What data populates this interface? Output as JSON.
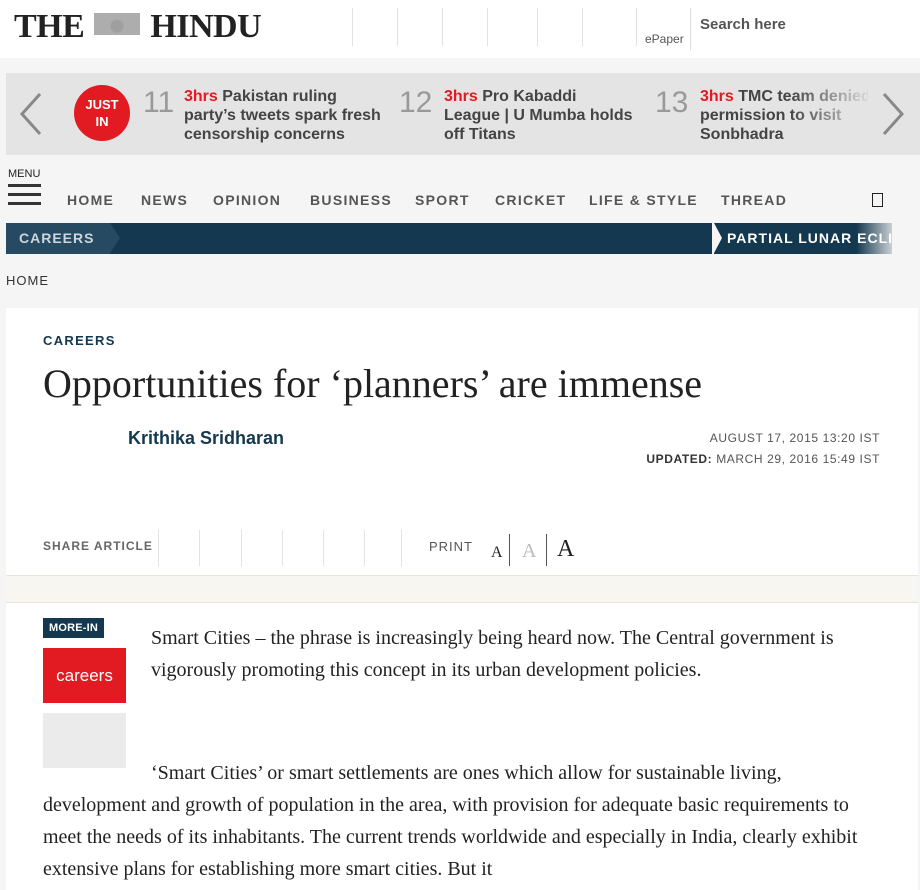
{
  "header": {
    "logo_left": "THE",
    "logo_right": "HINDU",
    "epaper": "ePaper",
    "search_placeholder": "Search here"
  },
  "ticker": {
    "badge": "JUST IN",
    "items": [
      {
        "num": "11",
        "time": "3hrs",
        "text": " Pakistan ruling party’s tweets spark fresh censorship concerns"
      },
      {
        "num": "12",
        "time": "3hrs",
        "text": " Pro Kabaddi League | U Mumba holds off Titans"
      },
      {
        "num": "13",
        "time": "3hrs",
        "text": " TMC team denied permission to visit Sonbhadra"
      }
    ]
  },
  "menu": {
    "label": "MENU",
    "items": [
      "HOME",
      "NEWS",
      "OPINION",
      "BUSINESS",
      "SPORT",
      "CRICKET",
      "LIFE & STYLE",
      "THREAD"
    ]
  },
  "section_bar": {
    "current": "CAREERS",
    "trending": "PARTIAL LUNAR ECLIPSE"
  },
  "breadcrumb": "HOME",
  "article": {
    "kicker": "CAREERS",
    "title": "Opportunities for ‘planners’ are immense",
    "author": "Krithika Sridharan",
    "published": "AUGUST 17, 2015 13:20 IST",
    "updated_label": "UPDATED:",
    "updated": "MARCH 29, 2016 15:49 IST",
    "share_label": "SHARE ARTICLE",
    "print_label": "PRINT",
    "font_sizes": [
      "A",
      "A",
      "A"
    ],
    "more_in": "MORE-IN",
    "tag": "careers",
    "paragraph1": "Smart Cities – the phrase is increasingly being heard now. The Central government is vigorously promoting this concept in its urban development policies.",
    "paragraph2": "‘Smart Cities’ or smart settlements are ones which allow for sustainable living, development and growth of population in the area, with provision for adequate basic requirements to meet the needs of its inhabitants. The current trends worldwide and especially in India, clearly exhibit extensive plans for establishing more smart cities. But it"
  },
  "colors": {
    "brand_red": "#e21b23",
    "navy": "#14384f"
  }
}
